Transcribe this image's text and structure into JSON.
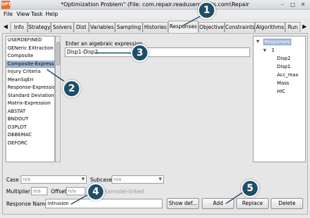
{
  "window": {
    "title": "*Optimization Problem\" (File: com.repair.readuserresults.com\\Repair",
    "app_icon_text": "OPT",
    "min_glyph": "–",
    "max_glyph": "□",
    "close_glyph": "✕"
  },
  "menu": {
    "file": "File",
    "view": "View",
    "task": "Task",
    "help": "Help"
  },
  "tabs": {
    "left_arrow": "◀",
    "right_arrow": "▶",
    "items": [
      "Info",
      "Strategy",
      "Solvers",
      "Dist",
      "Variables",
      "Sampling",
      "Histories",
      "Responses",
      "Objective",
      "Constraints",
      "Algorithms",
      "Run"
    ],
    "active": "Responses"
  },
  "response_types": {
    "items": [
      "USERDEFINED",
      "GENeric EXtraction",
      "Composite",
      "Composite-Expression",
      "Injury Criteria",
      "MeanSqErr",
      "Response-Expression",
      "Standard Deviation",
      "Matrix-Expression",
      "ABSTAT",
      "BNDOUT",
      "D3PLOT",
      "DBBEMAC",
      "DEFORC"
    ],
    "selected": "Composite-Expression"
  },
  "expression": {
    "label": "Enter an algebraic expression",
    "value": "Disp1-Disp2"
  },
  "tree": {
    "root": "Responses",
    "group": "1",
    "items": [
      "Disp2",
      "Disp1",
      "Acc_max",
      "Mass",
      "HIC"
    ]
  },
  "form": {
    "case_label": "Case",
    "case_value": "n/a",
    "subcase_label": "Subcase",
    "subcase_value": "n/a",
    "multiplier_label": "Multiplier",
    "multiplier_value": "n/a",
    "offset_label": "Offset",
    "offset_value": "n/a",
    "metamodel_label": "metamodel-linked",
    "response_name_label": "Response Name",
    "response_name_value": "Intrusion"
  },
  "buttons": {
    "show_def": "Show def...",
    "add": "Add",
    "replace": "Replace",
    "delete": "Delete"
  },
  "callouts": [
    "1",
    "2",
    "3",
    "4",
    "5"
  ]
}
